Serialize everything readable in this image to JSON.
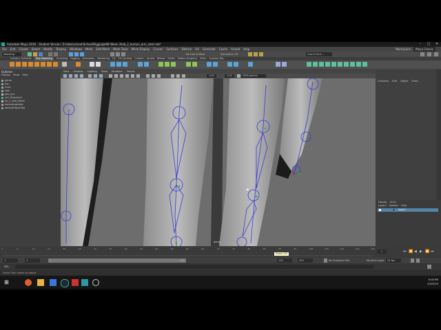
{
  "window": {
    "title": "Autodesk Maya 2016 - Student Version: D:\\data\\school\\School\\Rigging\\HW Week 3\\lab_2_human_arm_start.mb*"
  },
  "menubar": [
    "File",
    "Edit",
    "Create",
    "Select",
    "Modify",
    "Display",
    "Windows",
    "Mesh",
    "Edit Mesh",
    "Mesh Tools",
    "Mesh Display",
    "Curves",
    "Surfaces",
    "Deform",
    "UV",
    "Generate",
    "Cache",
    "Arnold",
    "Help"
  ],
  "statusline": {
    "mode": "Modeling",
    "surface": "No Live Surface",
    "symmetry": "Symmetry: Off",
    "workspace_label": "Workspace:",
    "workspace_value": "Maya Classic",
    "sign_in": "Grand Vorzi..."
  },
  "shelf_tabs": [
    "Curves / Surfaces",
    "Poly Modeling",
    "Sculpting",
    "Rigging",
    "Animation",
    "Rendering",
    "FX",
    "FX Caching",
    "Custom",
    "Arnold",
    "Bifrost",
    "MASH",
    "Motion Graphics",
    "XGen",
    "Custom_Rig"
  ],
  "shelf_active_tab": "Poly Modeling",
  "outliner": {
    "title": "Outliner",
    "menu": [
      "Display",
      "Show",
      "Help"
    ],
    "items": [
      "persp",
      "top",
      "front",
      "side",
      "geo_grp",
      "ctrl_Shoulder1",
      "jnt_L_shld_offset",
      "defaultLightSet",
      "defaultObjectSet"
    ]
  },
  "viewport": {
    "menu": [
      "View",
      "Shading",
      "Lighting",
      "Show",
      "Renderer",
      "Panels"
    ],
    "camera_label": "persp",
    "near_value": "0.00",
    "far_value": "1.00",
    "color_space": "sRGB gamma"
  },
  "channel_box": {
    "menu": [
      "Channels",
      "Edit",
      "Object",
      "Show"
    ],
    "layer_tabs": [
      "Display",
      "Anim"
    ],
    "layer_menu": [
      "Layers",
      "Options",
      "Help"
    ],
    "layer_name": "layer1"
  },
  "timeline": {
    "tick_labels": [
      "1",
      "5",
      "10",
      "15",
      "20",
      "25",
      "30",
      "35",
      "40",
      "45",
      "50",
      "55",
      "60",
      "65",
      "70",
      "75",
      "80",
      "85",
      "90",
      "95",
      "100",
      "105",
      "110",
      "115",
      "120"
    ],
    "current_frame": "1",
    "tooltip": "Frame 120"
  },
  "range": {
    "start": "1",
    "start_inner": "1",
    "end_inner": "120",
    "end": "120",
    "end_max": "200",
    "character_set": "No Character Set",
    "anim_layer": "No Anim Layer",
    "fps": "24 fps"
  },
  "command_line": {
    "lang": "MEL"
  },
  "help_line": "Select Tool: select an object",
  "taskbar": {
    "time": "6:08 PM",
    "date": "4/4/2020"
  }
}
